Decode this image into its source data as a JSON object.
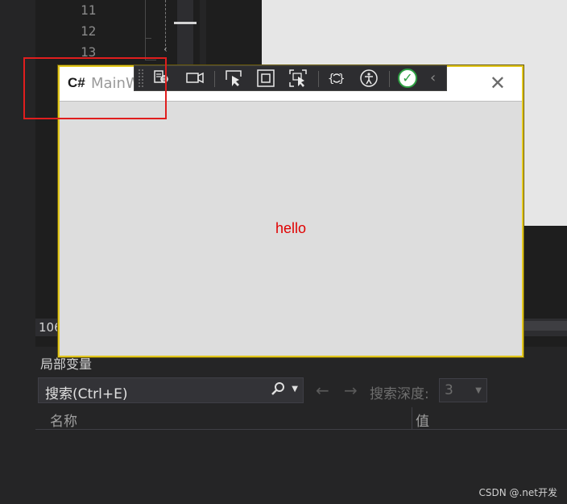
{
  "editor": {
    "line_numbers": [
      "11",
      "12",
      "13"
    ]
  },
  "status": {
    "zoom": "106"
  },
  "locals": {
    "title": "局部变量",
    "search_placeholder": "搜索(Ctrl+E)",
    "search_depth_label": "搜索深度:",
    "search_depth_value": "3",
    "columns": {
      "name": "名称",
      "value": "值"
    }
  },
  "app_window": {
    "title": "MainW",
    "icon_label": "C#",
    "content_text": "hello",
    "content_text_color": "#e00000",
    "border_color": "#e3c81f"
  },
  "runtime_toolbar": {
    "buttons": [
      "go-to-live-visual-tree-icon",
      "video-camera-icon",
      "select-element-icon",
      "display-layout-adorners-icon",
      "track-focus-icon",
      "binding-failures-icon",
      "accessibility-icon",
      "check-circle-icon",
      "collapse-chevron-icon"
    ]
  },
  "highlight_color": "#e01e1e",
  "watermark": "CSDN @.net开发"
}
